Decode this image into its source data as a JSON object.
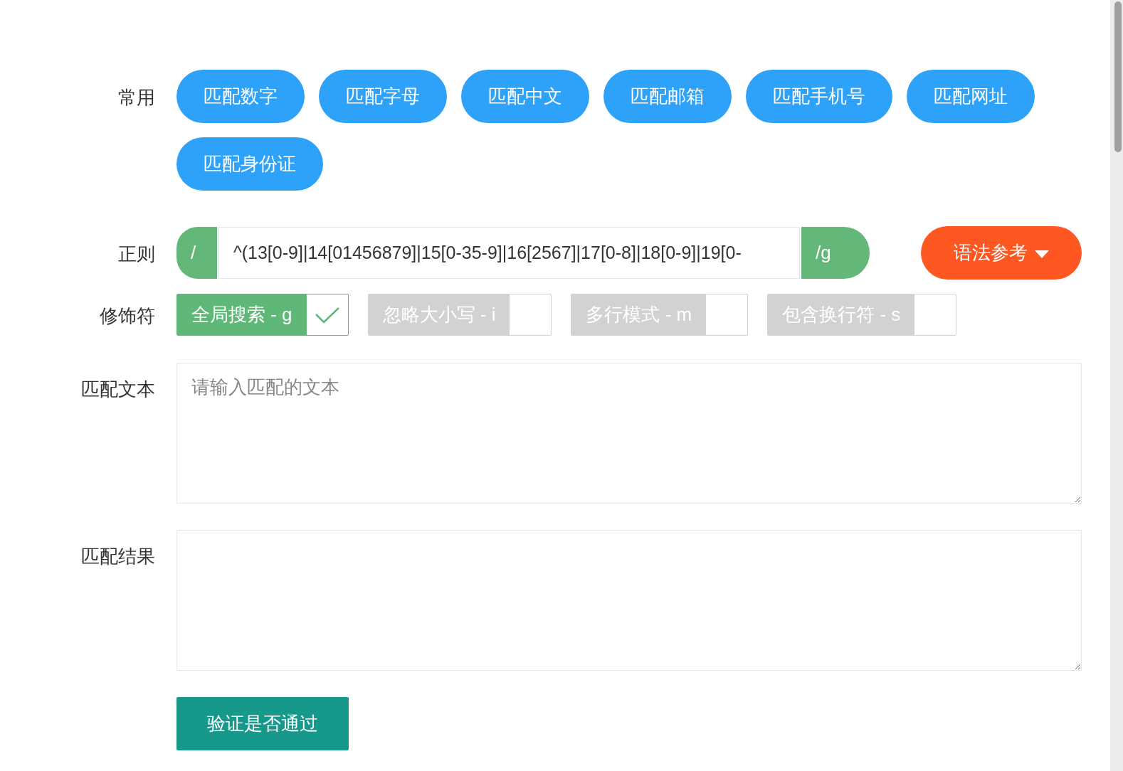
{
  "common": {
    "label": "常用",
    "buttons": [
      {
        "label": "匹配数字"
      },
      {
        "label": "匹配字母"
      },
      {
        "label": "匹配中文"
      },
      {
        "label": "匹配邮箱"
      },
      {
        "label": "匹配手机号"
      },
      {
        "label": "匹配网址"
      },
      {
        "label": "匹配身份证"
      }
    ]
  },
  "regex": {
    "label": "正则",
    "prefix": "/",
    "value": "^(13[0-9]|14[01456879]|15[0-35-9]|16[2567]|17[0-8]|18[0-9]|19[0-",
    "suffix": "/g",
    "syntax_button": "语法参考"
  },
  "modifiers": {
    "label": "修饰符",
    "items": [
      {
        "label": "全局搜索 - g",
        "checked": true
      },
      {
        "label": "忽略大小写 - i",
        "checked": false
      },
      {
        "label": "多行模式 - m",
        "checked": false
      },
      {
        "label": "包含换行符 - s",
        "checked": false
      }
    ]
  },
  "match_text": {
    "label": "匹配文本",
    "placeholder": "请输入匹配的文本"
  },
  "match_result": {
    "label": "匹配结果"
  },
  "verify_button": "验证是否通过"
}
